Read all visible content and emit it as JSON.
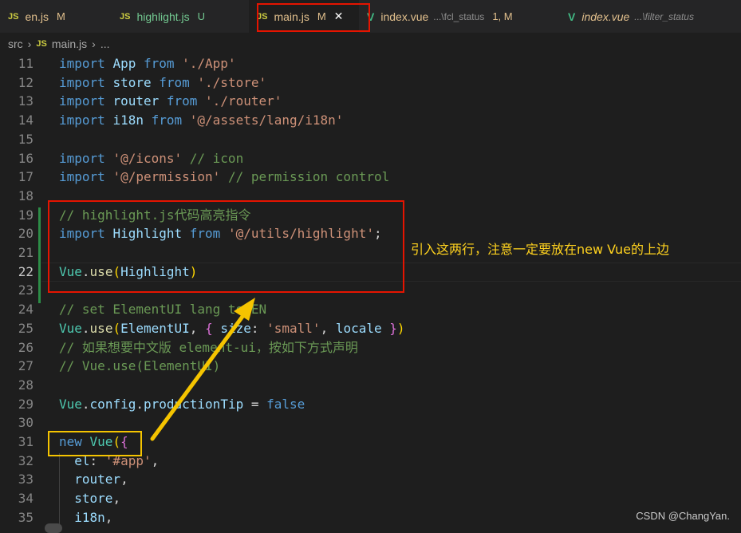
{
  "tabs": [
    {
      "badge": "JS",
      "name": "en.js",
      "status": "M",
      "name_color": "#e2c08d",
      "status_color": "#e2c08d"
    },
    {
      "badge": "JS",
      "name": "highlight.js",
      "status": "U",
      "name_color": "#73c991",
      "status_color": "#73c991"
    },
    {
      "badge": "JS",
      "name": "main.js",
      "status": "M",
      "name_color": "#e2c08d",
      "status_color": "#e2c08d",
      "active": true
    },
    {
      "badge": "V",
      "name": "index.vue",
      "path": "...\\fcl_status",
      "status": "1, M",
      "name_color": "#e2c08d",
      "status_color": "#e2c08d"
    },
    {
      "badge": "V",
      "name": "index.vue",
      "path": "...\\filter_status",
      "status": "",
      "name_color": "#e2c08d",
      "status_color": "#e2c08d",
      "italic": true
    }
  ],
  "breadcrumb": {
    "folder": "src",
    "badge": "JS",
    "file": "main.js",
    "more": "..."
  },
  "lines": [
    {
      "n": "11",
      "tokens": [
        [
          "kw",
          "import "
        ],
        [
          "id",
          "App "
        ],
        [
          "kw",
          "from "
        ],
        [
          "str",
          "'./App'"
        ]
      ]
    },
    {
      "n": "12",
      "tokens": [
        [
          "kw",
          "import "
        ],
        [
          "id",
          "store "
        ],
        [
          "kw",
          "from "
        ],
        [
          "str",
          "'./store'"
        ]
      ]
    },
    {
      "n": "13",
      "tokens": [
        [
          "kw",
          "import "
        ],
        [
          "id",
          "router "
        ],
        [
          "kw",
          "from "
        ],
        [
          "str",
          "'./router'"
        ]
      ]
    },
    {
      "n": "14",
      "tokens": [
        [
          "kw",
          "import "
        ],
        [
          "id",
          "i18n "
        ],
        [
          "kw",
          "from "
        ],
        [
          "str",
          "'@/assets/lang/i18n'"
        ]
      ]
    },
    {
      "n": "15",
      "tokens": []
    },
    {
      "n": "16",
      "tokens": [
        [
          "kw",
          "import "
        ],
        [
          "str",
          "'@/icons' "
        ],
        [
          "cm",
          "// icon"
        ]
      ]
    },
    {
      "n": "17",
      "tokens": [
        [
          "kw",
          "import "
        ],
        [
          "str",
          "'@/permission' "
        ],
        [
          "cm",
          "// permission control"
        ]
      ]
    },
    {
      "n": "18",
      "tokens": []
    },
    {
      "n": "19",
      "tokens": [
        [
          "cm",
          "// highlight.js代码高亮指令"
        ]
      ]
    },
    {
      "n": "20",
      "tokens": [
        [
          "kw",
          "import "
        ],
        [
          "id",
          "Highlight "
        ],
        [
          "kw",
          "from "
        ],
        [
          "str",
          "'@/utils/highlight'"
        ],
        [
          "pl",
          ";"
        ]
      ]
    },
    {
      "n": "21",
      "tokens": []
    },
    {
      "n": "22",
      "tokens": [
        [
          "ty",
          "Vue"
        ],
        [
          "pl",
          "."
        ],
        [
          "fn",
          "use"
        ],
        [
          "br2",
          "("
        ],
        [
          "id",
          "Highlight"
        ],
        [
          "br2",
          ")"
        ]
      ],
      "active": true
    },
    {
      "n": "23",
      "tokens": []
    },
    {
      "n": "24",
      "tokens": [
        [
          "cm",
          "// set ElementUI lang to EN"
        ]
      ]
    },
    {
      "n": "25",
      "tokens": [
        [
          "ty",
          "Vue"
        ],
        [
          "pl",
          "."
        ],
        [
          "fn",
          "use"
        ],
        [
          "br2",
          "("
        ],
        [
          "id",
          "ElementUI"
        ],
        [
          "pl",
          ", "
        ],
        [
          "br1",
          "{ "
        ],
        [
          "id",
          "size"
        ],
        [
          "pl",
          ": "
        ],
        [
          "str",
          "'small'"
        ],
        [
          "pl",
          ", "
        ],
        [
          "id",
          "locale "
        ],
        [
          "br1",
          "}"
        ],
        [
          "br2",
          ")"
        ]
      ]
    },
    {
      "n": "26",
      "tokens": [
        [
          "cm",
          "// 如果想要中文版 element-ui，按如下方式声明"
        ]
      ]
    },
    {
      "n": "27",
      "tokens": [
        [
          "cm",
          "// Vue.use(ElementUI)"
        ]
      ]
    },
    {
      "n": "28",
      "tokens": []
    },
    {
      "n": "29",
      "tokens": [
        [
          "ty",
          "Vue"
        ],
        [
          "pl",
          "."
        ],
        [
          "id",
          "config"
        ],
        [
          "pl",
          "."
        ],
        [
          "id",
          "productionTip "
        ],
        [
          "pl",
          "= "
        ],
        [
          "kw",
          "false"
        ]
      ]
    },
    {
      "n": "30",
      "tokens": []
    },
    {
      "n": "31",
      "tokens": [
        [
          "kw",
          "new "
        ],
        [
          "ty",
          "Vue"
        ],
        [
          "br2",
          "("
        ],
        [
          "br1",
          "{"
        ]
      ]
    },
    {
      "n": "32",
      "tokens": [
        [
          "id",
          "  el"
        ],
        [
          "pl",
          ": "
        ],
        [
          "str",
          "'#app'"
        ],
        [
          "pl",
          ","
        ]
      ]
    },
    {
      "n": "33",
      "tokens": [
        [
          "id",
          "  router"
        ],
        [
          "pl",
          ","
        ]
      ]
    },
    {
      "n": "34",
      "tokens": [
        [
          "id",
          "  store"
        ],
        [
          "pl",
          ","
        ]
      ]
    },
    {
      "n": "35",
      "tokens": [
        [
          "id",
          "  i18n"
        ],
        [
          "pl",
          ","
        ]
      ]
    }
  ],
  "annotation": "引入这两行，注意一定要放在new Vue的上边",
  "watermark": "CSDN @ChangYan.",
  "colors": {
    "red_box": "#e51400",
    "yellow_box": "#f5c400",
    "arrow": "#f5c400"
  }
}
